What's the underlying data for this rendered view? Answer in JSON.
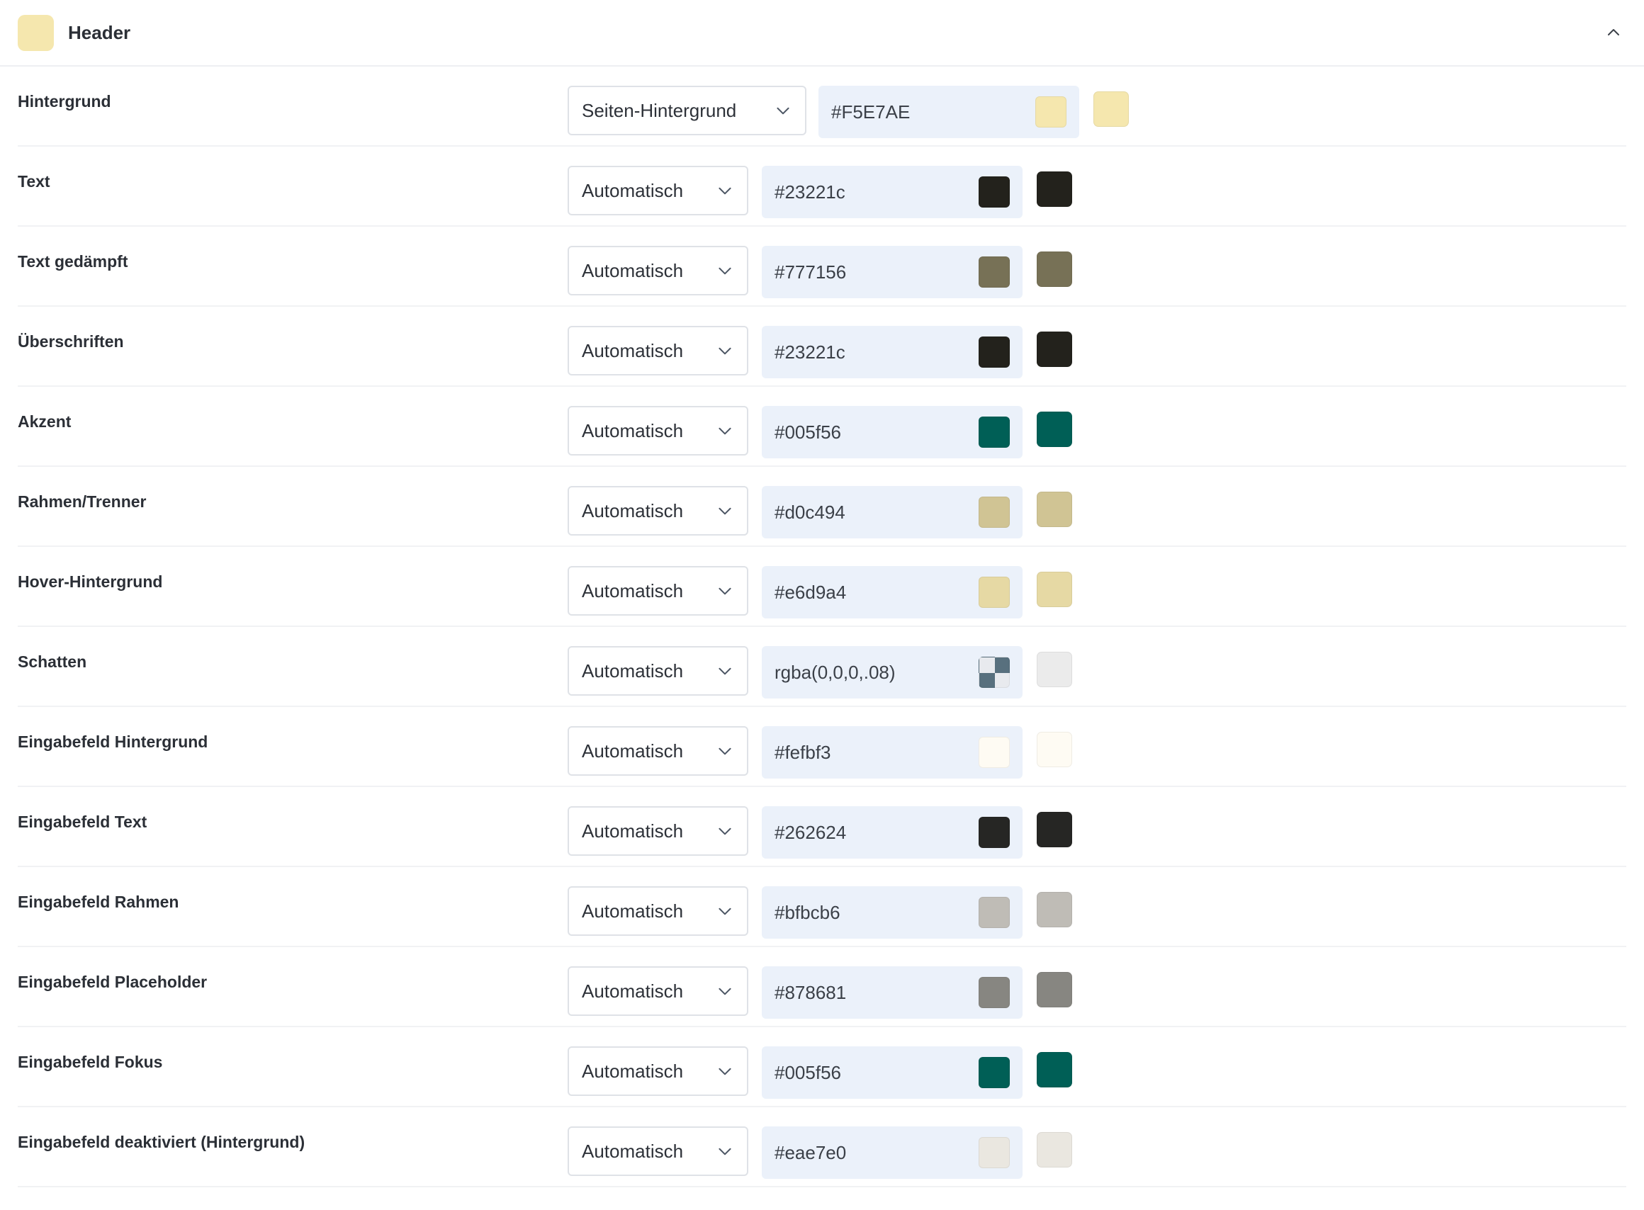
{
  "header": {
    "title": "Header",
    "swatch_color": "#F5E7AE",
    "collapse_icon": "chevron-up-icon"
  },
  "rows": [
    {
      "label": "Hintergrund",
      "select": "Seiten-Hintergrund",
      "value": "#F5E7AE",
      "color": "#F5E7AE"
    },
    {
      "label": "Text",
      "select": "Automatisch",
      "value": "#23221c",
      "color": "#23221c"
    },
    {
      "label": "Text gedämpft",
      "select": "Automatisch",
      "value": "#777156",
      "color": "#777156"
    },
    {
      "label": "Überschriften",
      "select": "Automatisch",
      "value": "#23221c",
      "color": "#23221c"
    },
    {
      "label": "Akzent",
      "select": "Automatisch",
      "value": "#005f56",
      "color": "#005f56"
    },
    {
      "label": "Rahmen/Trenner",
      "select": "Automatisch",
      "value": "#d0c494",
      "color": "#d0c494"
    },
    {
      "label": "Hover-Hintergrund",
      "select": "Automatisch",
      "value": "#e6d9a4",
      "color": "#e6d9a4"
    },
    {
      "label": "Schatten",
      "select": "Automatisch",
      "value": "rgba(0,0,0,.08)",
      "color": "rgba(0,0,0,.08)",
      "transparent": true
    },
    {
      "label": "Eingabefeld Hintergrund",
      "select": "Automatisch",
      "value": "#fefbf3",
      "color": "#fefbf3"
    },
    {
      "label": "Eingabefeld Text",
      "select": "Automatisch",
      "value": "#262624",
      "color": "#262624"
    },
    {
      "label": "Eingabefeld Rahmen",
      "select": "Automatisch",
      "value": "#bfbcb6",
      "color": "#bfbcb6"
    },
    {
      "label": "Eingabefeld Placeholder",
      "select": "Automatisch",
      "value": "#878681",
      "color": "#878681"
    },
    {
      "label": "Eingabefeld Fokus",
      "select": "Automatisch",
      "value": "#005f56",
      "color": "#005f56"
    },
    {
      "label": "Eingabefeld deaktiviert (Hintergrund)",
      "select": "Automatisch",
      "value": "#eae7e0",
      "color": "#eae7e0"
    }
  ]
}
